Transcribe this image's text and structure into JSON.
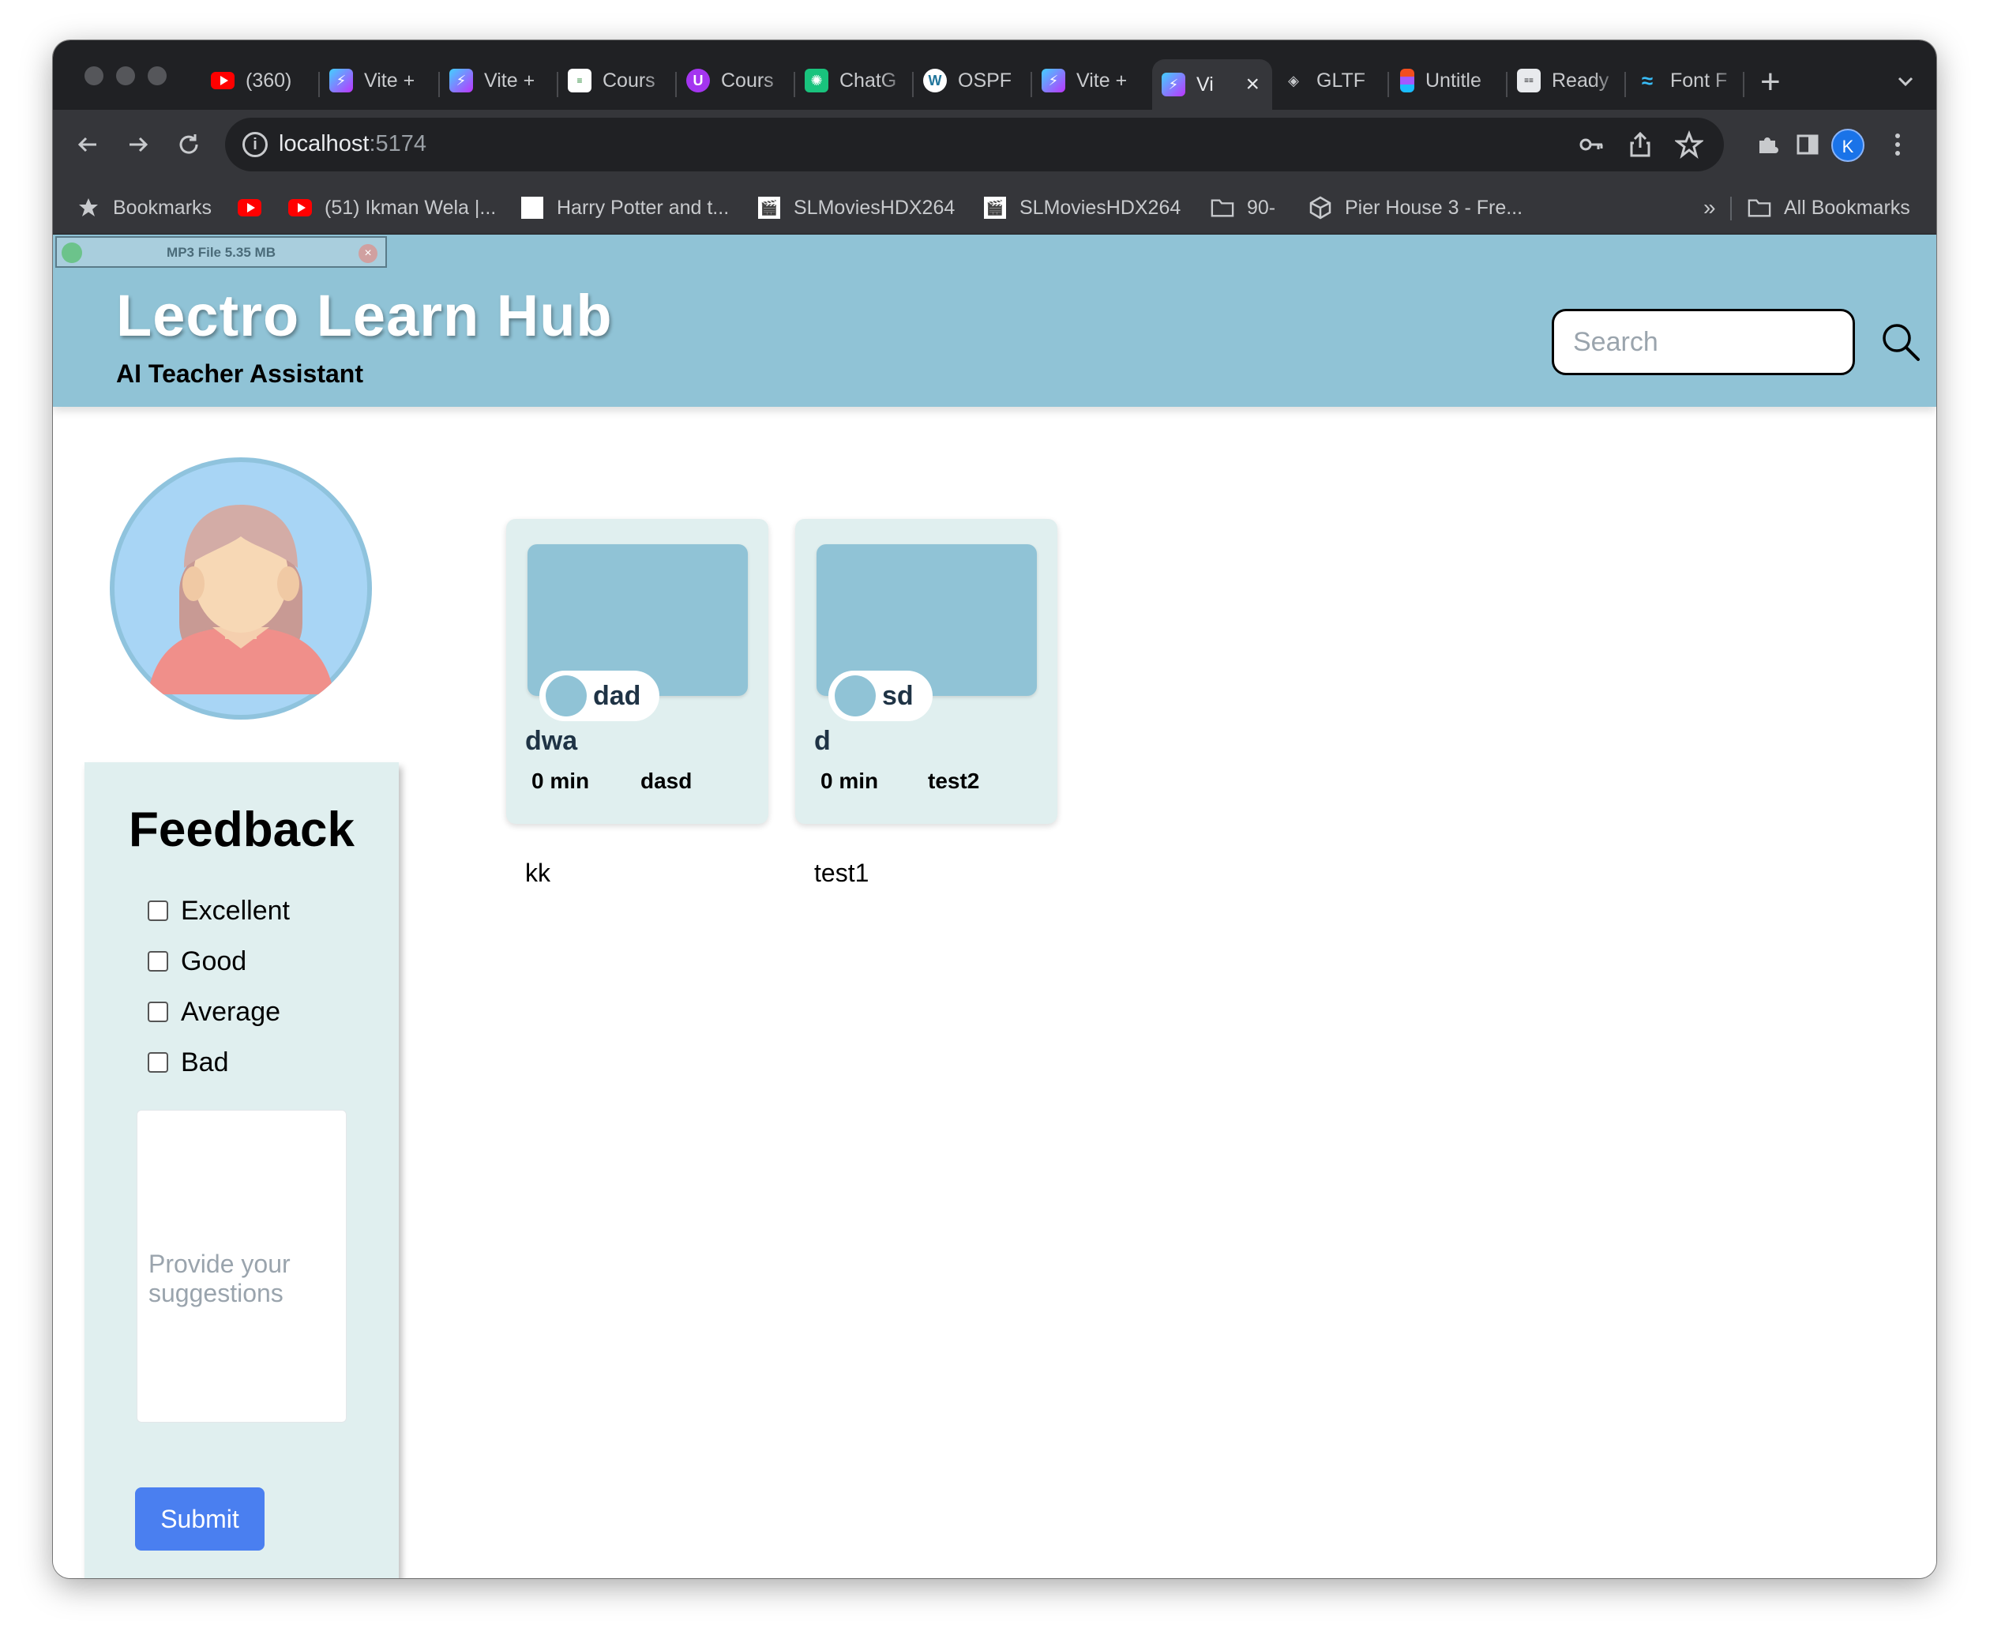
{
  "browser": {
    "tabs": [
      {
        "title": "(360)",
        "icon": "youtube-icon"
      },
      {
        "title": "Vite +",
        "icon": "vite-icon"
      },
      {
        "title": "Vite +",
        "icon": "vite-icon"
      },
      {
        "title": "Cours",
        "icon": "course-icon"
      },
      {
        "title": "Cours",
        "icon": "udemy-icon"
      },
      {
        "title": "ChatG",
        "icon": "chatgpt-icon"
      },
      {
        "title": "OSPF",
        "icon": "wordpress-icon"
      },
      {
        "title": "Vite +",
        "icon": "vite-icon"
      },
      {
        "title": "Vi",
        "icon": "vite-icon",
        "active": true
      },
      {
        "title": "GLTF",
        "icon": "gltf-icon"
      },
      {
        "title": "Untitle",
        "icon": "figma-icon"
      },
      {
        "title": "Ready",
        "icon": "ready-icon"
      },
      {
        "title": "Font F",
        "icon": "tailwind-icon"
      }
    ],
    "address": {
      "host": "localhost",
      "port": ":5174"
    },
    "profile_initial": "K",
    "bookmarks": [
      {
        "label": "Bookmarks",
        "icon": "star-icon"
      },
      {
        "label": "",
        "icon": "youtube-icon"
      },
      {
        "label": "(51) Ikman Wela |...",
        "icon": "youtube-icon"
      },
      {
        "label": "Harry Potter and t...",
        "icon": "page-icon"
      },
      {
        "label": "SLMoviesHDX264",
        "icon": "movie-icon"
      },
      {
        "label": "SLMoviesHDX264",
        "icon": "movie-icon"
      },
      {
        "label": "90-",
        "icon": "folder-icon"
      },
      {
        "label": "Pier House 3 - Fre...",
        "icon": "unity-icon"
      }
    ],
    "overflow_label": "»",
    "all_bookmarks": "All Bookmarks"
  },
  "extension_bar": {
    "label": "MP3 File 5.35 MB",
    "close": "×"
  },
  "header": {
    "title": "Lectro Learn Hub",
    "subtitle": "AI Teacher Assistant",
    "search_placeholder": "Search"
  },
  "feedback": {
    "title": "Feedback",
    "options": [
      "Excellent",
      "Good",
      "Average",
      "Bad"
    ],
    "textarea_placeholder": "Provide your suggestions",
    "submit_label": "Submit"
  },
  "courses": [
    {
      "author": "dad",
      "title": "dwa",
      "duration": "0 min",
      "category": "dasd",
      "caption": "kk"
    },
    {
      "author": "sd",
      "title": "d",
      "duration": "0 min",
      "category": "test2",
      "caption": "test1"
    }
  ],
  "colors": {
    "header_bg": "#90c3d6",
    "panel_bg": "#e0efef",
    "submit_bg": "#4a7ff0",
    "chrome_dark": "#202124",
    "chrome_toolbar": "#35363a"
  }
}
